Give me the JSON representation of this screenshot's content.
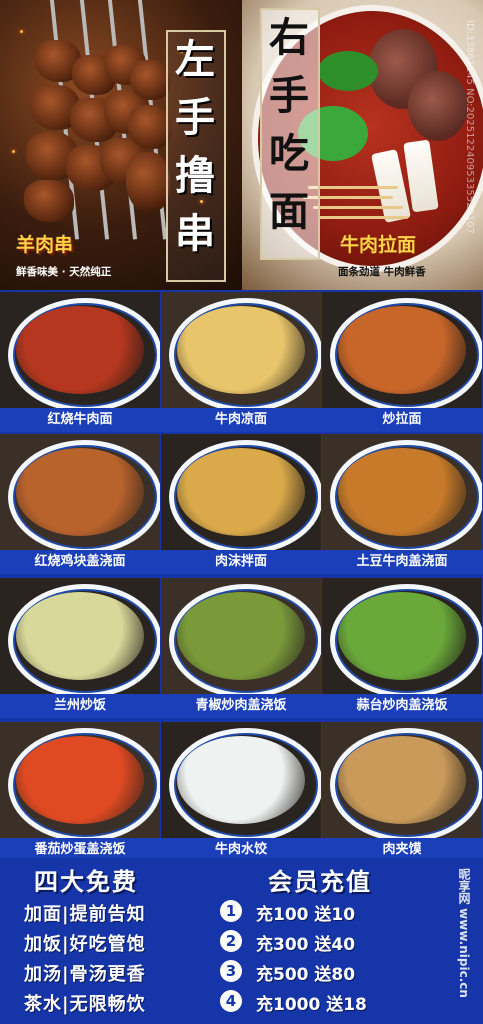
{
  "hero": {
    "left_title": [
      "左",
      "手",
      "撸",
      "串"
    ],
    "right_title": [
      "右",
      "手",
      "吃",
      "面"
    ],
    "left_label": "羊肉串",
    "left_sub": "鲜香味美 · 天然纯正",
    "right_label": "牛肉拉面",
    "right_sub": "面条劲道  牛肉鲜香",
    "id_text": "ID:33861145 NO:20251224095335529107"
  },
  "dishes": [
    {
      "name": "红烧牛肉面",
      "color": "#b5371f"
    },
    {
      "name": "牛肉凉面",
      "color": "#e8c56a"
    },
    {
      "name": "炒拉面",
      "color": "#c8662a"
    },
    {
      "name": "红烧鸡块盖浇面",
      "color": "#b8622c"
    },
    {
      "name": "肉沫拌面",
      "color": "#d9a94a"
    },
    {
      "name": "土豆牛肉盖浇面",
      "color": "#c77a2a"
    },
    {
      "name": "兰州炒饭",
      "color": "#d8d89a"
    },
    {
      "name": "青椒炒肉盖浇饭",
      "color": "#7a9a3a"
    },
    {
      "name": "蒜台炒肉盖浇饭",
      "color": "#6aa83a"
    },
    {
      "name": "番茄炒蛋盖浇饭",
      "color": "#e04a22"
    },
    {
      "name": "牛肉水饺",
      "color": "#eef2f0"
    },
    {
      "name": "肉夹馍",
      "color": "#c99a5a"
    }
  ],
  "promo": {
    "free_title": "四大免费",
    "member_title": "会员充值",
    "free_items": [
      "加面|提前告知",
      "加饭|好吃管饱",
      "加汤|骨汤更香",
      "茶水|无限畅饮"
    ],
    "recharge": [
      {
        "num": "1",
        "text": "充100  送10"
      },
      {
        "num": "2",
        "text": "充300  送40"
      },
      {
        "num": "3",
        "text": "充500  送80"
      },
      {
        "num": "4",
        "text": "充1000  送18"
      }
    ],
    "watermark": "昵享网 www.nipic.cn"
  }
}
